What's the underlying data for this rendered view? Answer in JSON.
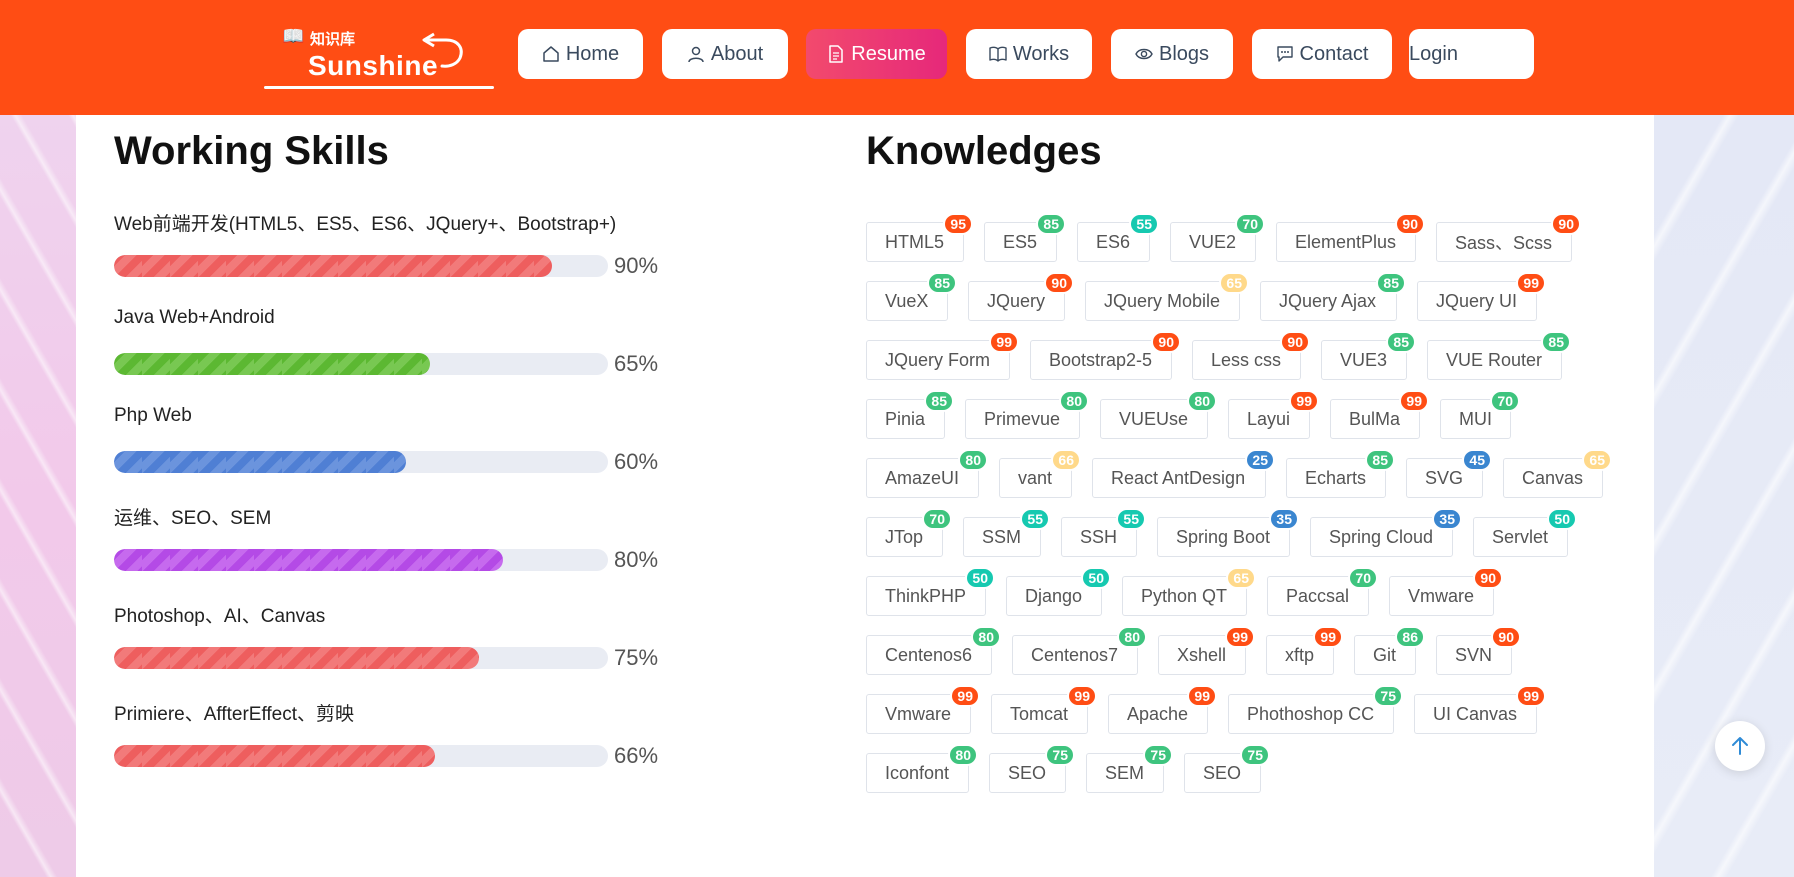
{
  "brand": {
    "kb": "知识库",
    "name": "Sunshine"
  },
  "nav": [
    {
      "label": "Home",
      "icon": "home-icon",
      "active": false
    },
    {
      "label": "About",
      "icon": "user-icon",
      "active": false
    },
    {
      "label": "Resume",
      "icon": "document-icon",
      "active": true
    },
    {
      "label": "Works",
      "icon": "book-icon",
      "active": false
    },
    {
      "label": "Blogs",
      "icon": "eye-icon",
      "active": false
    },
    {
      "label": "Contact",
      "icon": "chat-icon",
      "active": false
    },
    {
      "label": "Login",
      "icon": "",
      "active": false
    }
  ],
  "skills": {
    "title": "Working Skills",
    "items": [
      {
        "name": "Web前端开发(HTML5、ES5、ES6、JQuery+、Bootstrap+)",
        "percent": 90,
        "label": "90%",
        "color": "#ee5e5e",
        "stripe": "#f27a7a"
      },
      {
        "name": "Java Web+Android",
        "percent": 65,
        "label": "65%",
        "color": "#5cb832",
        "stripe": "#78c852"
      },
      {
        "name": "Php Web",
        "percent": 60,
        "label": "60%",
        "color": "#4f7fd4",
        "stripe": "#6b94dd"
      },
      {
        "name": "运维、SEO、SEM",
        "percent": 80,
        "label": "80%",
        "color": "#b44ae6",
        "stripe": "#c66aee"
      },
      {
        "name": "Photoshop、AI、Canvas",
        "percent": 75,
        "label": "75%",
        "color": "#ee5e5e",
        "stripe": "#f27a7a"
      },
      {
        "name": "Primiere、AffterEffect、剪映",
        "percent": 66,
        "label": "66%",
        "color": "#ee5e5e",
        "stripe": "#f27a7a"
      }
    ]
  },
  "knowledges": {
    "title": "Knowledges",
    "badge_colors": {
      "red": "#ff4d14",
      "green": "#3ec47e",
      "teal": "#16c9b0",
      "yellow": "#ffd98a",
      "blue": "#3a86d0"
    },
    "rows": [
      [
        {
          "t": "HTML5",
          "v": "95",
          "c": "red"
        },
        {
          "t": "ES5",
          "v": "85",
          "c": "green"
        },
        {
          "t": "ES6",
          "v": "55",
          "c": "teal"
        },
        {
          "t": "VUE2",
          "v": "70",
          "c": "green"
        },
        {
          "t": "ElementPlus",
          "v": "90",
          "c": "red"
        },
        {
          "t": "Sass、Scss",
          "v": "90",
          "c": "red"
        }
      ],
      [
        {
          "t": "VueX",
          "v": "85",
          "c": "green"
        },
        {
          "t": "JQuery",
          "v": "90",
          "c": "red"
        },
        {
          "t": "JQuery Mobile",
          "v": "65",
          "c": "yellow"
        },
        {
          "t": "JQuery Ajax",
          "v": "85",
          "c": "green"
        },
        {
          "t": "JQuery UI",
          "v": "99",
          "c": "red"
        }
      ],
      [
        {
          "t": "JQuery Form",
          "v": "99",
          "c": "red"
        },
        {
          "t": "Bootstrap2-5",
          "v": "90",
          "c": "red"
        },
        {
          "t": "Less css",
          "v": "90",
          "c": "red"
        },
        {
          "t": "VUE3",
          "v": "85",
          "c": "green"
        },
        {
          "t": "VUE Router",
          "v": "85",
          "c": "green"
        }
      ],
      [
        {
          "t": "Pinia",
          "v": "85",
          "c": "green"
        },
        {
          "t": "Primevue",
          "v": "80",
          "c": "green"
        },
        {
          "t": "VUEUse",
          "v": "80",
          "c": "green"
        },
        {
          "t": "Layui",
          "v": "99",
          "c": "red"
        },
        {
          "t": "BulMa",
          "v": "99",
          "c": "red"
        },
        {
          "t": "MUI",
          "v": "70",
          "c": "green"
        }
      ],
      [
        {
          "t": "AmazeUI",
          "v": "80",
          "c": "green"
        },
        {
          "t": "vant",
          "v": "66",
          "c": "yellow"
        },
        {
          "t": "React AntDesign",
          "v": "25",
          "c": "blue"
        },
        {
          "t": "Echarts",
          "v": "85",
          "c": "green"
        },
        {
          "t": "SVG",
          "v": "45",
          "c": "blue"
        },
        {
          "t": "Canvas",
          "v": "65",
          "c": "yellow"
        }
      ],
      [
        {
          "t": "JTop",
          "v": "70",
          "c": "green"
        },
        {
          "t": "SSM",
          "v": "55",
          "c": "teal"
        },
        {
          "t": "SSH",
          "v": "55",
          "c": "teal"
        },
        {
          "t": "Spring Boot",
          "v": "35",
          "c": "blue"
        },
        {
          "t": "Spring Cloud",
          "v": "35",
          "c": "blue"
        },
        {
          "t": "Servlet",
          "v": "50",
          "c": "teal"
        }
      ],
      [
        {
          "t": "ThinkPHP",
          "v": "50",
          "c": "teal"
        },
        {
          "t": "Django",
          "v": "50",
          "c": "teal"
        },
        {
          "t": "Python QT",
          "v": "65",
          "c": "yellow"
        },
        {
          "t": "Paccsal",
          "v": "70",
          "c": "green"
        },
        {
          "t": "Vmware",
          "v": "90",
          "c": "red"
        }
      ],
      [
        {
          "t": "Centenos6",
          "v": "80",
          "c": "green"
        },
        {
          "t": "Centenos7",
          "v": "80",
          "c": "green"
        },
        {
          "t": "Xshell",
          "v": "99",
          "c": "red"
        },
        {
          "t": "xftp",
          "v": "99",
          "c": "red"
        },
        {
          "t": "Git",
          "v": "86",
          "c": "green"
        },
        {
          "t": "SVN",
          "v": "90",
          "c": "red"
        }
      ],
      [
        {
          "t": "Vmware",
          "v": "99",
          "c": "red"
        },
        {
          "t": "Tomcat",
          "v": "99",
          "c": "red"
        },
        {
          "t": "Apache",
          "v": "99",
          "c": "red"
        },
        {
          "t": "Phothoshop CC",
          "v": "75",
          "c": "green"
        },
        {
          "t": "UI Canvas",
          "v": "99",
          "c": "red"
        }
      ],
      [
        {
          "t": "Iconfont",
          "v": "80",
          "c": "green"
        },
        {
          "t": "SEO",
          "v": "75",
          "c": "green"
        },
        {
          "t": "SEM",
          "v": "75",
          "c": "green"
        },
        {
          "t": "SEO",
          "v": "75",
          "c": "green"
        }
      ]
    ]
  },
  "scroll_top": {
    "icon": "arrow-up-icon"
  }
}
